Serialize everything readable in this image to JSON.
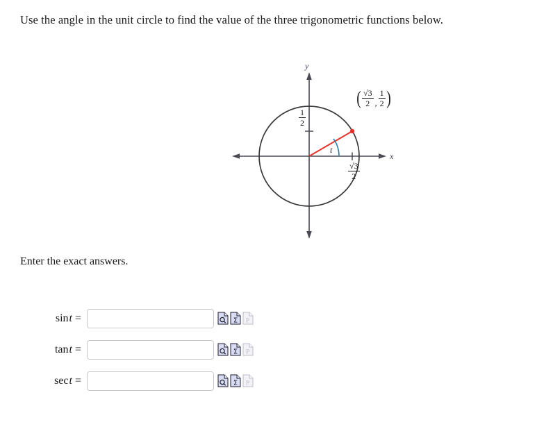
{
  "question": {
    "prompt": "Use the angle in the unit circle to find the value of the three trigonometric functions below.",
    "instruction": "Enter the exact answers."
  },
  "figure": {
    "type": "unit-circle",
    "axis_labels": {
      "x": "x",
      "y": "y"
    },
    "angle_label": "t",
    "y_tick_label": {
      "numerator": "1",
      "denominator": "2"
    },
    "x_tick_label": {
      "numerator": "√3",
      "denominator": "2"
    },
    "point_label": {
      "open_paren": "(",
      "x_numerator": "√3",
      "x_denominator": "2",
      "comma": ",",
      "y_numerator": "1",
      "y_denominator": "2",
      "close_paren": ")"
    },
    "colors": {
      "circle": "#3a3a3a",
      "axis": "#4a4a55",
      "radius": "#e8312a",
      "point": "#e8312a",
      "angle_arc": "#2b7fa8"
    }
  },
  "answers": {
    "rows": [
      {
        "function": "sin",
        "variable": "t",
        "equals": "=",
        "value": "",
        "placeholder": "",
        "icons": [
          {
            "name": "preview-icon",
            "glyph": "magnifier",
            "enabled": true
          },
          {
            "name": "math-editor-icon",
            "glyph": "Σ",
            "enabled": true
          },
          {
            "name": "print-icon",
            "glyph": "P",
            "enabled": false
          }
        ]
      },
      {
        "function": "tan",
        "variable": "t",
        "equals": "=",
        "value": "",
        "placeholder": "",
        "icons": [
          {
            "name": "preview-icon",
            "glyph": "magnifier",
            "enabled": true
          },
          {
            "name": "math-editor-icon",
            "glyph": "Σ",
            "enabled": true
          },
          {
            "name": "print-icon",
            "glyph": "P",
            "enabled": false
          }
        ]
      },
      {
        "function": "sec",
        "variable": "t",
        "equals": "=",
        "value": "",
        "placeholder": "",
        "icons": [
          {
            "name": "preview-icon",
            "glyph": "magnifier",
            "enabled": true
          },
          {
            "name": "math-editor-icon",
            "glyph": "Σ",
            "enabled": true
          },
          {
            "name": "print-icon",
            "glyph": "P",
            "enabled": false
          }
        ]
      }
    ]
  }
}
